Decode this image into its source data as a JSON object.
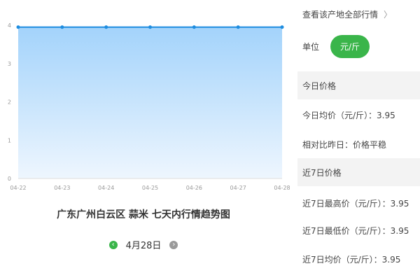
{
  "chart_data": {
    "type": "area",
    "x": [
      "04-22",
      "04-23",
      "04-24",
      "04-25",
      "04-26",
      "04-27",
      "04-28"
    ],
    "values": [
      3.95,
      3.95,
      3.95,
      3.95,
      3.95,
      3.95,
      3.95
    ],
    "ylim": [
      0,
      4
    ],
    "yticks": [
      "0",
      "1",
      "2",
      "3",
      "4"
    ],
    "line_color": "#1e8de0",
    "fill_top_color": "#a3d3fb",
    "fill_bottom_color": "#eef6fe"
  },
  "chart_title": "广东广州白云区 蒜米 七天内行情趋势图",
  "date_nav": {
    "prev_icon": "chevron-left-icon",
    "next_icon": "chevron-right-icon",
    "prev_glyph": "‹",
    "next_glyph": "›",
    "date": "4月28日"
  },
  "panel": {
    "view_all": "查看该产地全部行情",
    "view_all_chevron": "〉",
    "unit_label": "单位",
    "unit_value": "元/斤",
    "today_header": "今日价格",
    "today_avg": "今日均价（元/斤）：3.95",
    "compare": "相对比昨日：价格平稳",
    "week_header": "近7日价格",
    "week_high": "近7日最高价（元/斤）：3.95",
    "week_low": "近7日最低价（元/斤）：3.95",
    "week_avg": "近7日均价（元/斤）：3.95"
  },
  "colors": {
    "accent_green": "#3ab54a",
    "section_bg": "#f3f3f3"
  }
}
